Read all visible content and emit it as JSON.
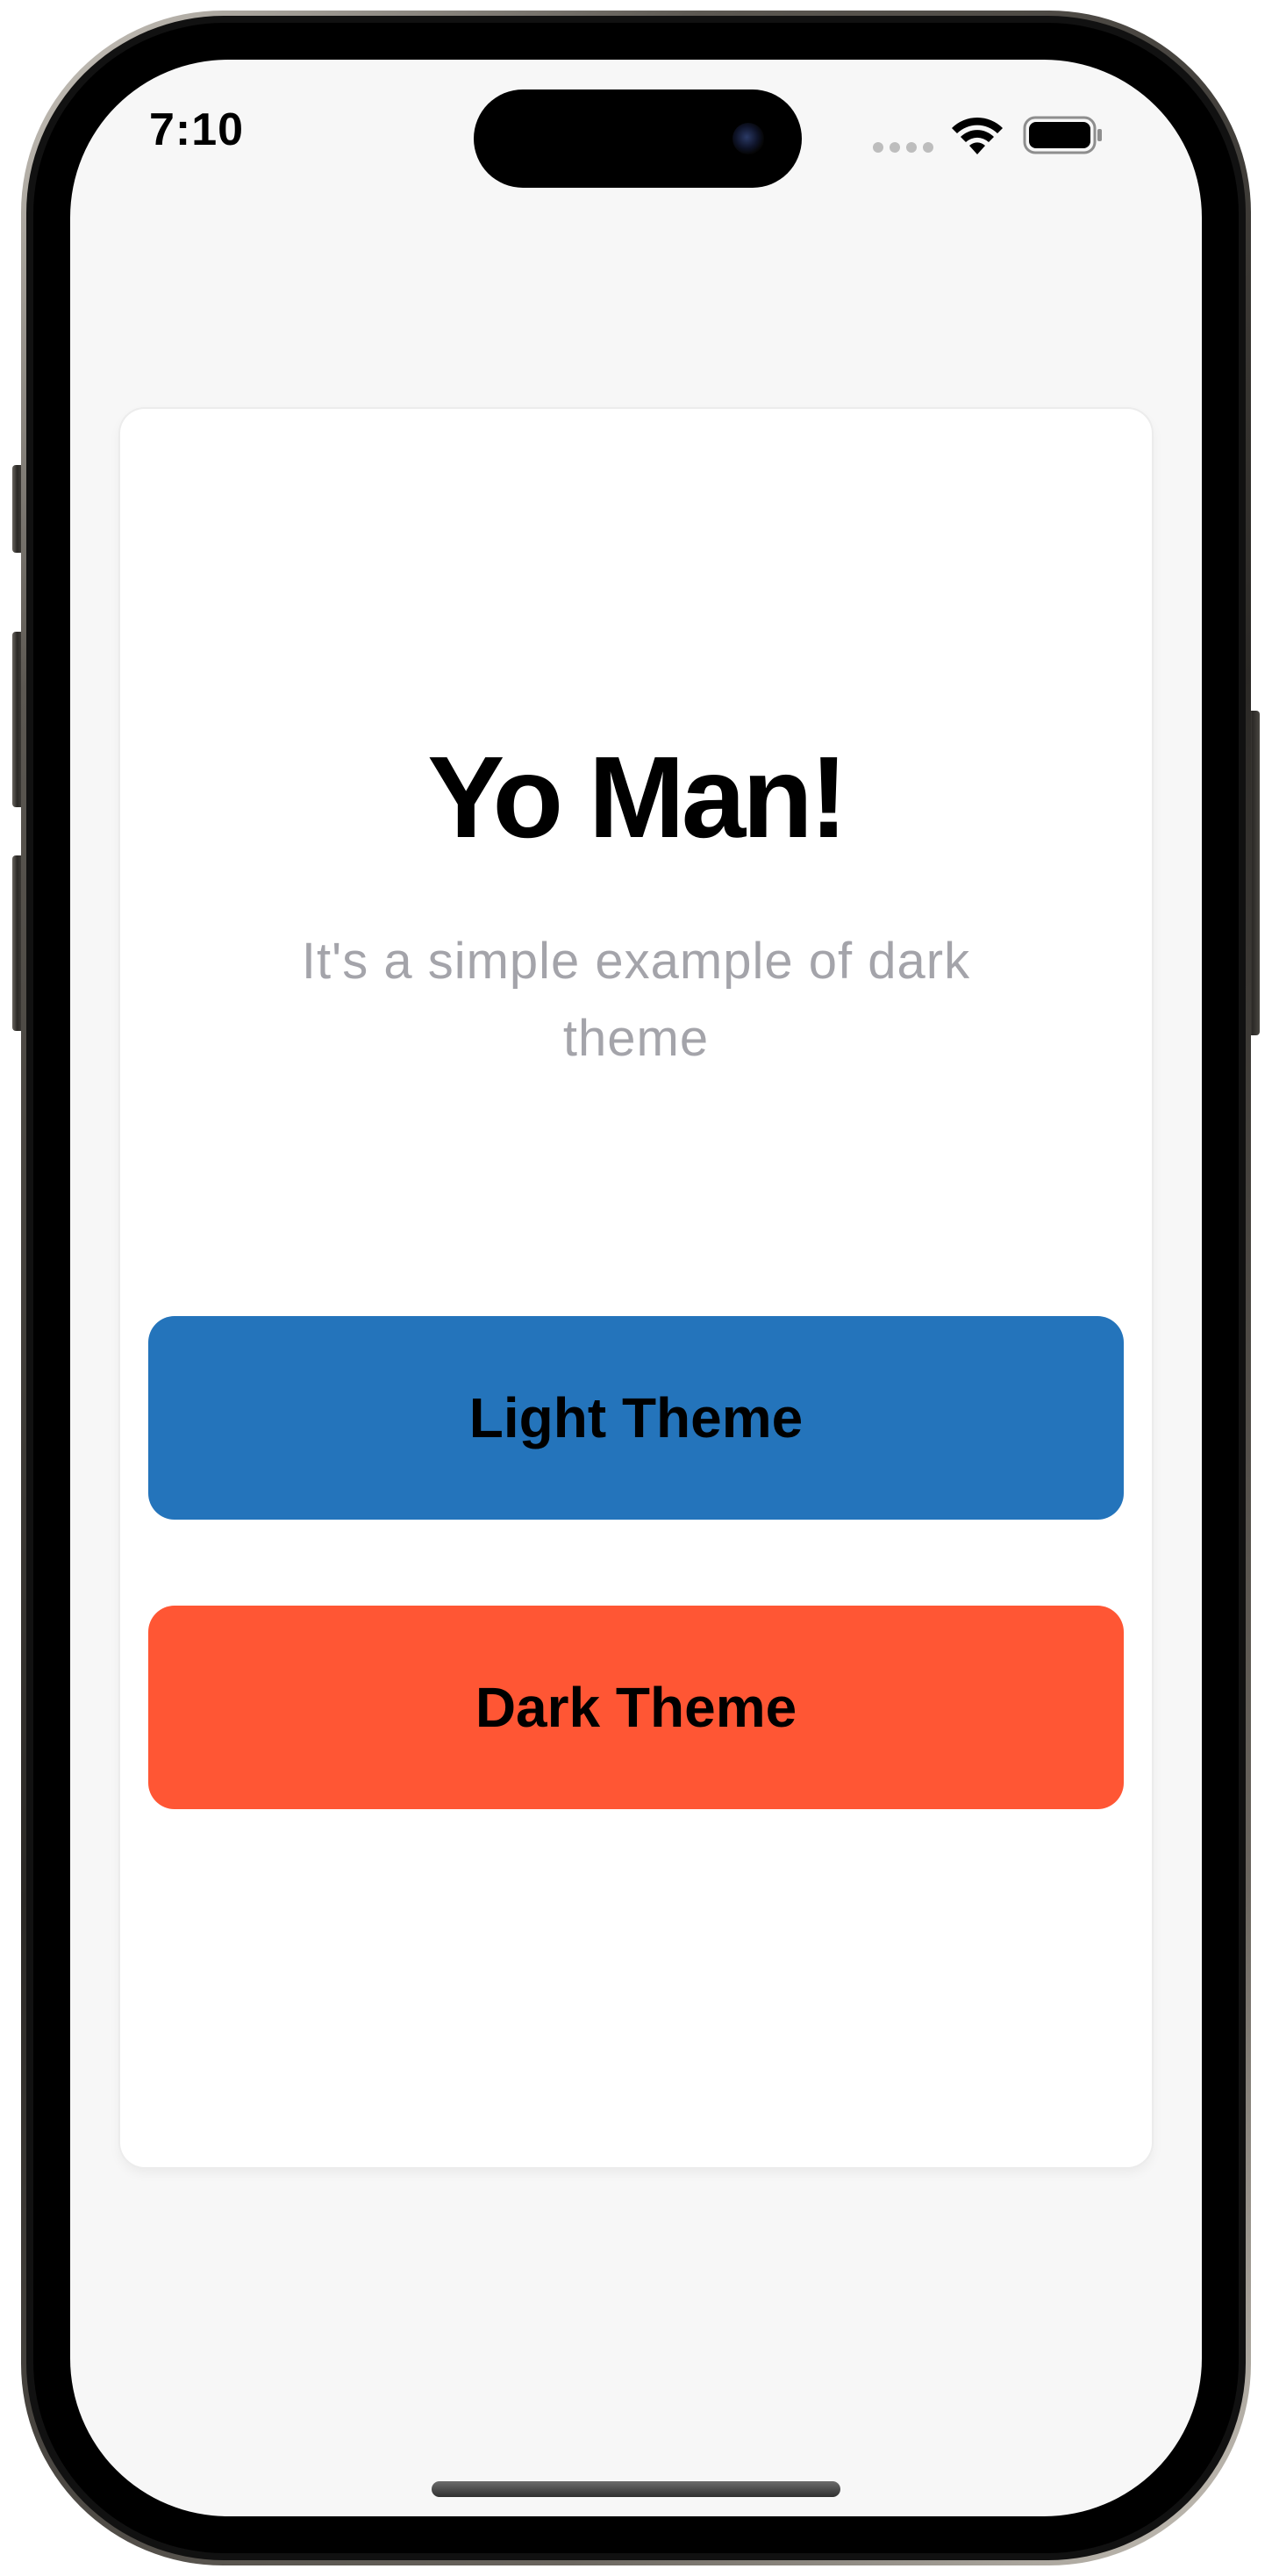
{
  "status_bar": {
    "time": "7:10",
    "icons": [
      "signal-dots-icon",
      "wifi-icon",
      "battery-icon"
    ]
  },
  "card": {
    "title": "Yo Man!",
    "subtitle": "It's a simple example of dark theme",
    "buttons": [
      {
        "label": "Light Theme",
        "color": "#2474bb"
      },
      {
        "label": "Dark Theme",
        "color": "#ff5634"
      }
    ]
  },
  "colors": {
    "screen_background": "#f7f7f7",
    "card_background": "#ffffff",
    "subtitle_text": "#a4a4aa"
  }
}
